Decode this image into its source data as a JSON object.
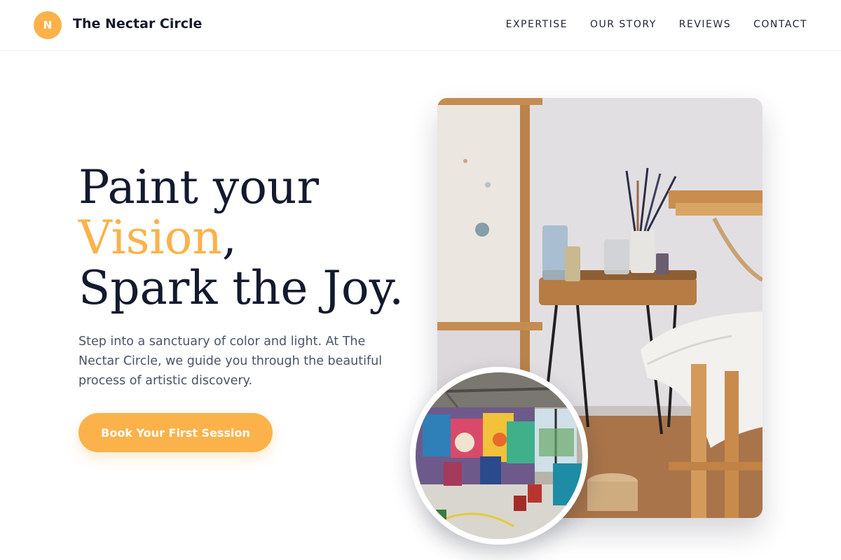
{
  "brand": {
    "logo_letter": "N",
    "name": "The Nectar Circle"
  },
  "nav": {
    "items": [
      {
        "label": "EXPERTISE"
      },
      {
        "label": "OUR STORY"
      },
      {
        "label": "REVIEWS"
      },
      {
        "label": "CONTACT"
      }
    ]
  },
  "hero": {
    "headline_line1": "Paint your",
    "headline_accent": "Vision",
    "headline_comma": ",",
    "headline_line3": "Spark the Joy.",
    "subtext": "Step into a sanctuary of color and light. At The Nectar Circle, we guide you through the beautiful process of artistic discovery.",
    "cta_label": "Book Your First Session"
  },
  "images": {
    "main_photo": "art-studio-still-life-photo",
    "inset_photo": "graffiti-studio-photo"
  },
  "colors": {
    "accent": "#fbb24a",
    "heading": "#141a2e",
    "body_text": "#4a5468"
  }
}
